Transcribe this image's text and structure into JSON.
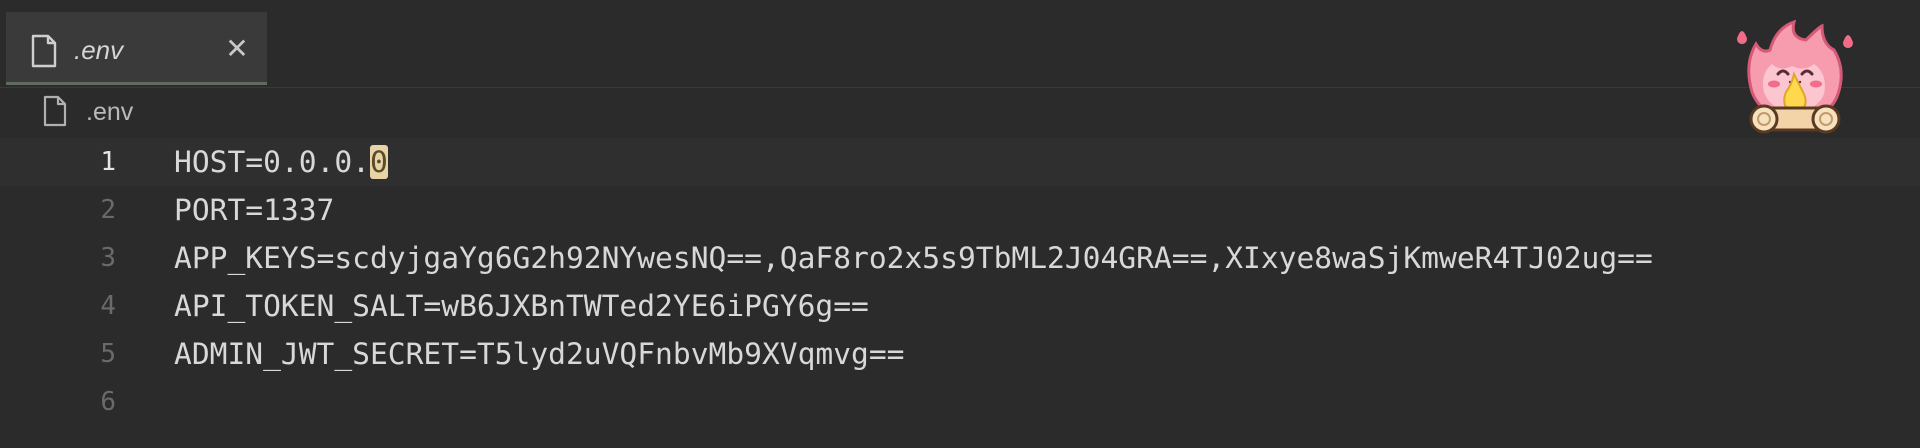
{
  "tab": {
    "title": ".env",
    "close_glyph": "✕",
    "icon": "file-icon"
  },
  "breadcrumb": {
    "label": ".env",
    "icon": "file-icon"
  },
  "editor": {
    "current_line": 1,
    "lines": [
      {
        "number": "1",
        "text_before_cursor": "HOST=0.0.0.",
        "cursor_char": "0"
      },
      {
        "number": "2",
        "text": "PORT=1337"
      },
      {
        "number": "3",
        "text": "APP_KEYS=scdyjgaYg6G2h92NYwesNQ==,QaF8ro2x5s9TbML2J04GRA==,XIxye8waSjKmweR4TJ02ug=="
      },
      {
        "number": "4",
        "text": "API_TOKEN_SALT=wB6JXBnTWTed2YE6iPGY6g=="
      },
      {
        "number": "5",
        "text": "ADMIN_JWT_SECRET=T5lyd2uVQFnbvMb9XVqmvg=="
      },
      {
        "number": "6",
        "text": ""
      }
    ]
  },
  "mascot": {
    "icon": "campfire-mascot-icon"
  },
  "colors": {
    "background": "#2b2b2b",
    "tab_active": "#3a3a3a",
    "current_line": "#2f2f2f",
    "cursor_highlight": "#e8d3a6",
    "text": "#d8d8d8",
    "gutter_text": "#6a6a6a"
  }
}
